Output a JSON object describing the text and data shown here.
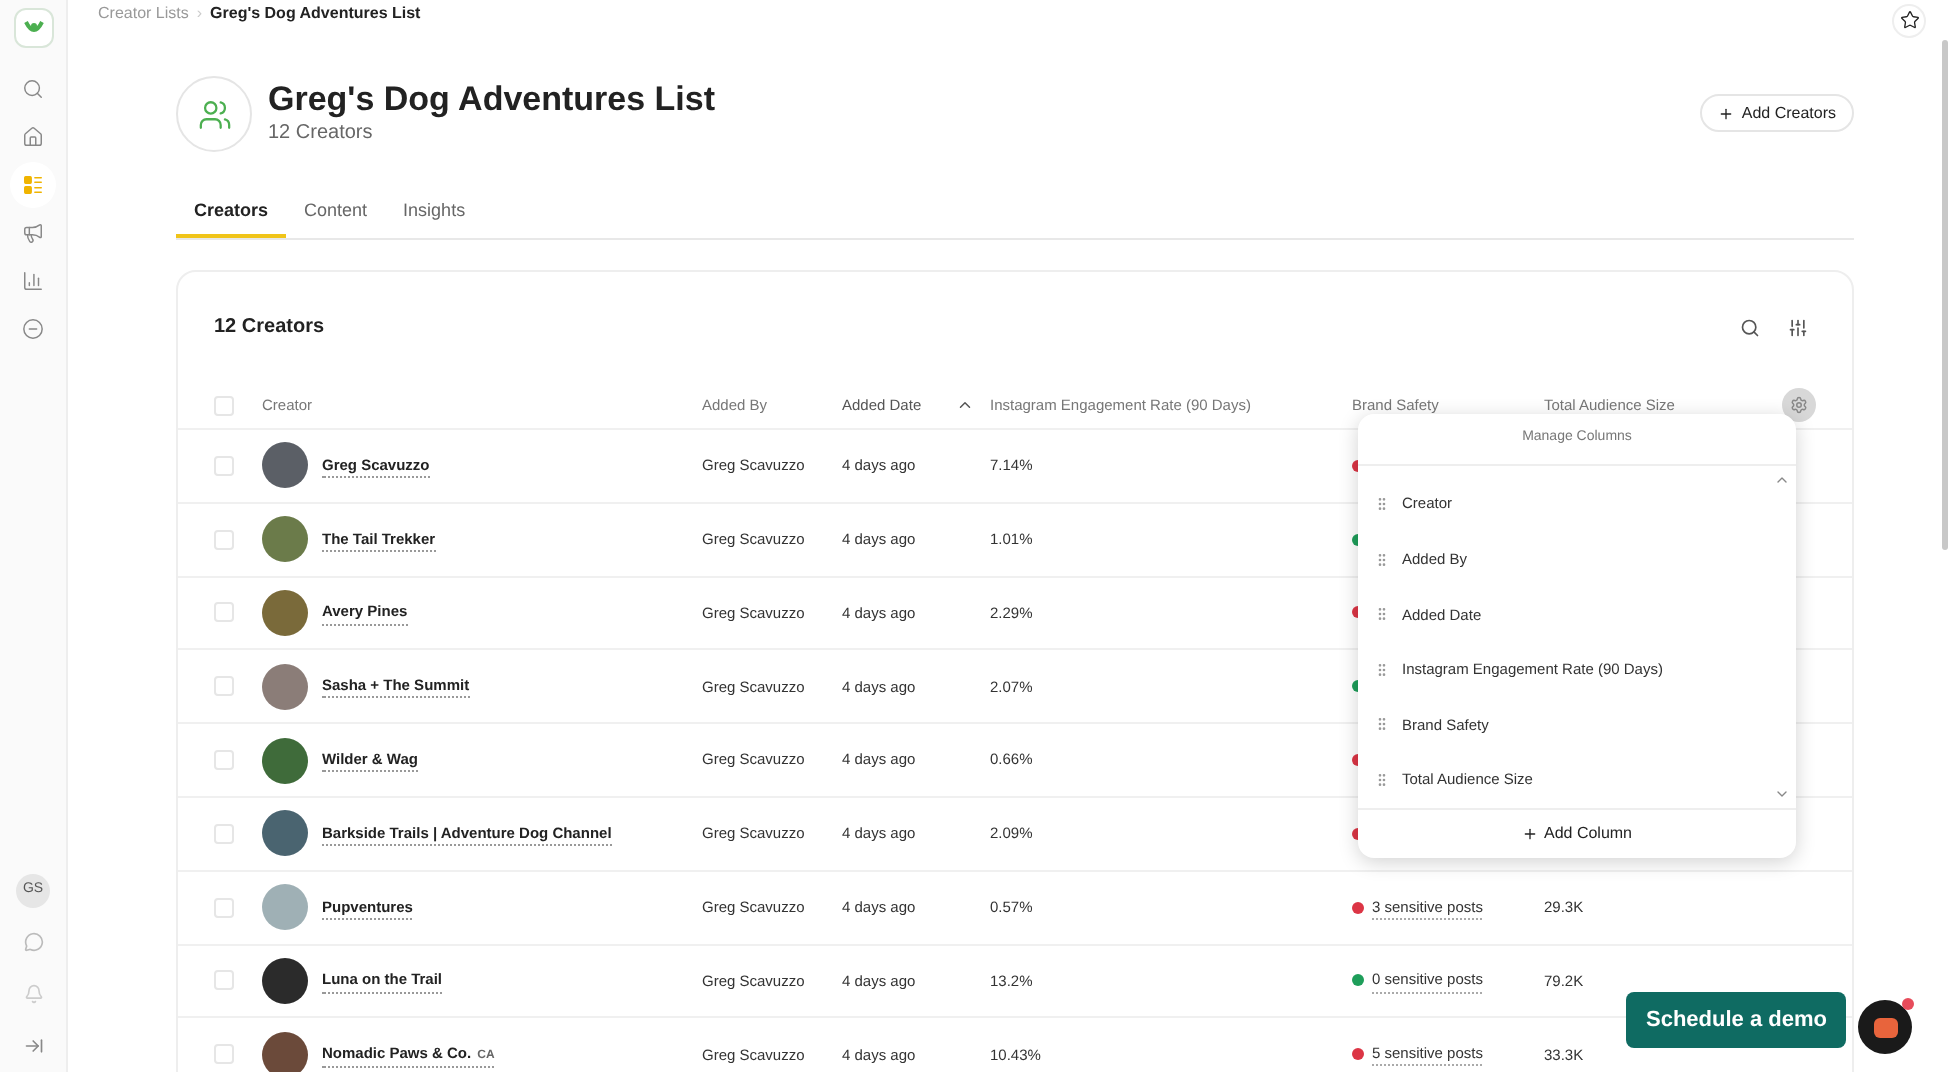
{
  "breadcrumb": [
    {
      "label": "Creator Lists",
      "current": false
    },
    {
      "label": "Greg's Dog Adventures List",
      "current": true
    }
  ],
  "breadcrumb_separator": "›",
  "sidebar": {
    "items": [
      {
        "kind": "search",
        "selected": false
      },
      {
        "kind": "home",
        "selected": false
      },
      {
        "kind": "lists",
        "selected": true
      },
      {
        "kind": "megaphone",
        "selected": false
      },
      {
        "kind": "chart",
        "selected": false
      },
      {
        "kind": "minus",
        "selected": false
      }
    ],
    "user_initials": "GS"
  },
  "header": {
    "title": "Greg's Dog Adventures List",
    "subtitle": "12 Creators",
    "add_button": "Add Creators"
  },
  "tabs": [
    {
      "label": "Creators",
      "selected": true
    },
    {
      "label": "Content",
      "selected": false
    },
    {
      "label": "Insights",
      "selected": false
    }
  ],
  "table": {
    "title": "12 Creators",
    "all_checked": false,
    "columns": [
      {
        "label": "Creator",
        "sorted": false
      },
      {
        "label": "Added By",
        "sorted": false
      },
      {
        "label": "Added Date",
        "sorted": true
      },
      {
        "label": "Instagram Engagement Rate (90 Days)",
        "sorted": false
      },
      {
        "label": "Brand Safety",
        "sorted": false
      },
      {
        "label": "Total Audience Size",
        "sorted": false
      }
    ],
    "rows": [
      {
        "checked": false,
        "creator": "Greg Scavuzzo",
        "added_by": "Greg Scavuzzo",
        "added_date": "4 days ago",
        "engagement": "7.14%",
        "color": "#dc3545"
      },
      {
        "checked": false,
        "creator": "The Tail Trekker",
        "added_by": "Greg Scavuzzo",
        "added_date": "4 days ago",
        "engagement": "1.01%",
        "color": "#1e9e5a"
      },
      {
        "checked": false,
        "creator": "Avery Pines",
        "added_by": "Greg Scavuzzo",
        "added_date": "4 days ago",
        "engagement": "2.29%",
        "color": "#dc3545"
      },
      {
        "checked": false,
        "creator": "Sasha + The Summit",
        "added_by": "Greg Scavuzzo",
        "added_date": "4 days ago",
        "engagement": "2.07%",
        "color": "#1e9e5a"
      },
      {
        "checked": false,
        "creator": "Wilder & Wag",
        "added_by": "Greg Scavuzzo",
        "added_date": "4 days ago",
        "engagement": "0.66%",
        "color": "#dc3545"
      },
      {
        "checked": false,
        "creator": "Barkside Trails | Adventure Dog Channel",
        "added_by": "Greg Scavuzzo",
        "added_date": "4 days ago",
        "engagement": "2.09%",
        "color": "#dc3545"
      },
      {
        "checked": false,
        "creator": "Pupventures",
        "added_by": "Greg Scavuzzo",
        "added_date": "4 days ago",
        "engagement": "0.57%",
        "color": "#dc3545",
        "brand_safety": "3 sensitive posts",
        "audience": "29.3K"
      },
      {
        "checked": false,
        "creator": "Luna on the Trail",
        "added_by": "Greg Scavuzzo",
        "added_date": "4 days ago",
        "engagement": "13.2%",
        "color": "#1e9e5a",
        "brand_safety": "0 sensitive posts",
        "audience": "79.2K"
      },
      {
        "checked": false,
        "creator": "Nomadic Paws & Co.",
        "creator_suffix": "CA",
        "added_by": "Greg Scavuzzo",
        "added_date": "4 days ago",
        "engagement": "10.43%",
        "color": "#dc3545",
        "brand_safety": "5 sensitive posts",
        "audience": "33.3K"
      }
    ]
  },
  "manage_columns": {
    "title": "Manage Columns",
    "items": [
      "Creator",
      "Added By",
      "Added Date",
      "Instagram Engagement Rate (90 Days)",
      "Brand Safety",
      "Total Audience Size"
    ],
    "add_button": "Add Column"
  },
  "demo_button": "Schedule a demo"
}
